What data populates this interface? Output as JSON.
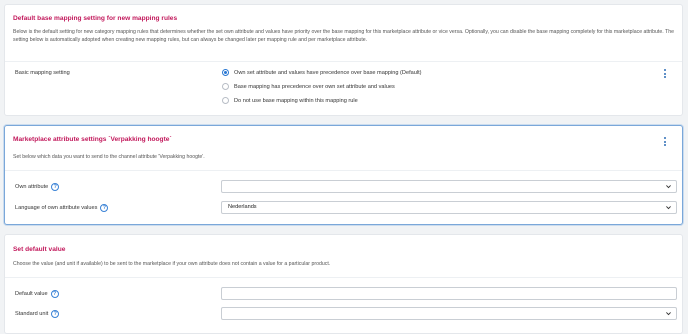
{
  "default_mapping": {
    "title": "Default base mapping setting for new mapping rules",
    "description": "Below is the default setting for new category mapping rules that determines whether the set own attribute and values have priority over the base mapping for this marketplace attribute or vice versa. Optionally, you can disable the base mapping completely for this marketplace attribute. The setting below is automatically adopted when creating new mapping rules, but can always be changed later per mapping rule and per marketplace attribute.",
    "field_label": "Basic mapping setting",
    "options": [
      {
        "label": "Own set attribute and values have precedence over base mapping (Default)",
        "checked": true
      },
      {
        "label": "Base mapping has precedence over own set attribute and values",
        "checked": false
      },
      {
        "label": "Do not use base mapping within this mapping rule",
        "checked": false
      }
    ]
  },
  "marketplace_attribute": {
    "title": "Marketplace attribute settings  `Verpakking hoogte`",
    "description": "Set below which data you want to send to the channel attribute 'Verpakking hoogte'.",
    "own_attribute_label": "Own attribute",
    "own_attribute_value": "",
    "language_label": "Language of own attribute values",
    "language_value": "Nederlands"
  },
  "default_value": {
    "title": "Set default value",
    "description": "Choose the value (and unit if available) to be sent to the marketplace if your own attribute does not contain a value for a particular product.",
    "default_value_label": "Default value",
    "default_value_value": "",
    "standard_unit_label": "Standard unit",
    "standard_unit_value": ""
  },
  "help_icon_glyph": "?",
  "colors": {
    "title": "#c2185b",
    "accent": "#2a78d3",
    "active_border": "#7aa7d9"
  },
  "icons": [
    "help-icon",
    "kebab-menu-icon",
    "chevron-down-icon"
  ]
}
